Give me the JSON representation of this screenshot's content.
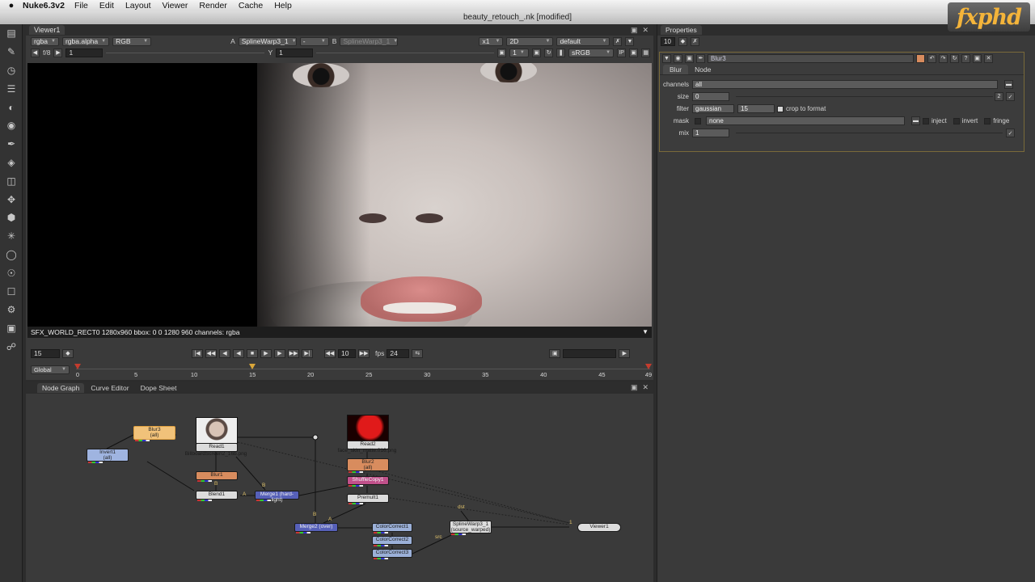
{
  "menubar": {
    "app_name": "Nuke6.3v2",
    "items": [
      "File",
      "Edit",
      "Layout",
      "Viewer",
      "Render",
      "Cache",
      "Help"
    ]
  },
  "window_title": "beauty_retouch_.nk [modified]",
  "logo_text": "fxphd",
  "toolbar_icons": [
    "viewer-icon",
    "paint-icon",
    "time-icon",
    "channel-icon",
    "color-icon",
    "filter-icon",
    "draw-icon",
    "keyer-icon",
    "merge-icon",
    "transform-icon",
    "3d-icon",
    "particle-icon",
    "deep-icon",
    "views-icon",
    "metadata-icon",
    "toolsets-icon",
    "other-icon",
    "plugin-icon"
  ],
  "viewer": {
    "tab": "Viewer1",
    "row1": {
      "channels": "rgba",
      "layer": "rgba.alpha",
      "display": "RGB",
      "a_label": "A",
      "a_input": "SplineWarp3_1",
      "op": "-",
      "b_label": "B",
      "b_input": "SplineWarp3_1",
      "zoom": "x1",
      "mode": "2D",
      "lut_set": "default"
    },
    "row2": {
      "fstop": "f/8",
      "gain": "1",
      "y_label": "Y",
      "gamma": "1",
      "proxy": "1",
      "colorspace": "sRGB"
    },
    "status": "SFX_WORLD_RECT0 1280x960 bbox: 0 0 1280 960 channels: rgba",
    "playback": {
      "frame": "15",
      "step": "10",
      "fps_label": "fps",
      "fps": "24"
    },
    "timeline": {
      "range_mode": "Global",
      "ticks": [
        "0",
        "5",
        "10",
        "15",
        "20",
        "25",
        "30",
        "35",
        "40",
        "45",
        "49"
      ],
      "current": 15,
      "first": 0,
      "last": 49
    }
  },
  "nodegraph": {
    "tabs": [
      "Node Graph",
      "Curve Editor",
      "Dope Sheet"
    ],
    "nodes": {
      "blur3": {
        "name": "Blur3",
        "sub": "(all)"
      },
      "invert1": {
        "name": "Invert1",
        "sub": "(all)"
      },
      "read1": {
        "name": "Read1",
        "file": "BillboardScreen2_16b.png"
      },
      "blur1": {
        "name": "Blur1"
      },
      "blend1": {
        "name": "Blend1"
      },
      "merge1": {
        "name": "Merge1 (hard-light)"
      },
      "read2": {
        "name": "Read2",
        "file": "face_skin_matte.016.png"
      },
      "blur2": {
        "name": "Blur2",
        "sub": "(all)"
      },
      "shufflecopy1": {
        "name": "ShuffleCopy1"
      },
      "premult1": {
        "name": "Premult1"
      },
      "merge2": {
        "name": "Merge2 (over)"
      },
      "colorcorrect1": {
        "name": "ColorCorrect1"
      },
      "colorcorrect2": {
        "name": "ColorCorrect2"
      },
      "colorcorrect3": {
        "name": "ColorCorrect3"
      },
      "splinewarp": {
        "name": "SplineWarp3_1",
        "sub": "(source_warped)"
      },
      "viewer1": {
        "name": "Viewer1"
      }
    },
    "edge_labels": {
      "a1": "A",
      "b1": "B",
      "b2": "B",
      "a2": "A",
      "dst": "dst",
      "src": "src",
      "one": "1"
    }
  },
  "properties": {
    "title": "Properties",
    "max_panels": "10",
    "node_name": "Blur3",
    "tabs": [
      "Blur",
      "Node"
    ],
    "fields": {
      "channels_label": "channels",
      "channels": "all",
      "size_label": "size",
      "size": "0",
      "size_count": "2",
      "filter_label": "filter",
      "filter": "gaussian",
      "filter_q": "15",
      "crop_label": "crop to format",
      "mask_label": "mask",
      "mask": "none",
      "inject_label": "inject",
      "invert_label": "invert",
      "fringe_label": "fringe",
      "mix_label": "mix",
      "mix": "1"
    }
  },
  "colors": {
    "panel": "#3a3a3a",
    "blur_node": "#d88c5e",
    "invert_node": "#9fb4e0",
    "merge_node": "#5660b8",
    "shuffle_node": "#c0508a",
    "cc_node": "#9bb0d8",
    "selected": "#f1c27a"
  }
}
